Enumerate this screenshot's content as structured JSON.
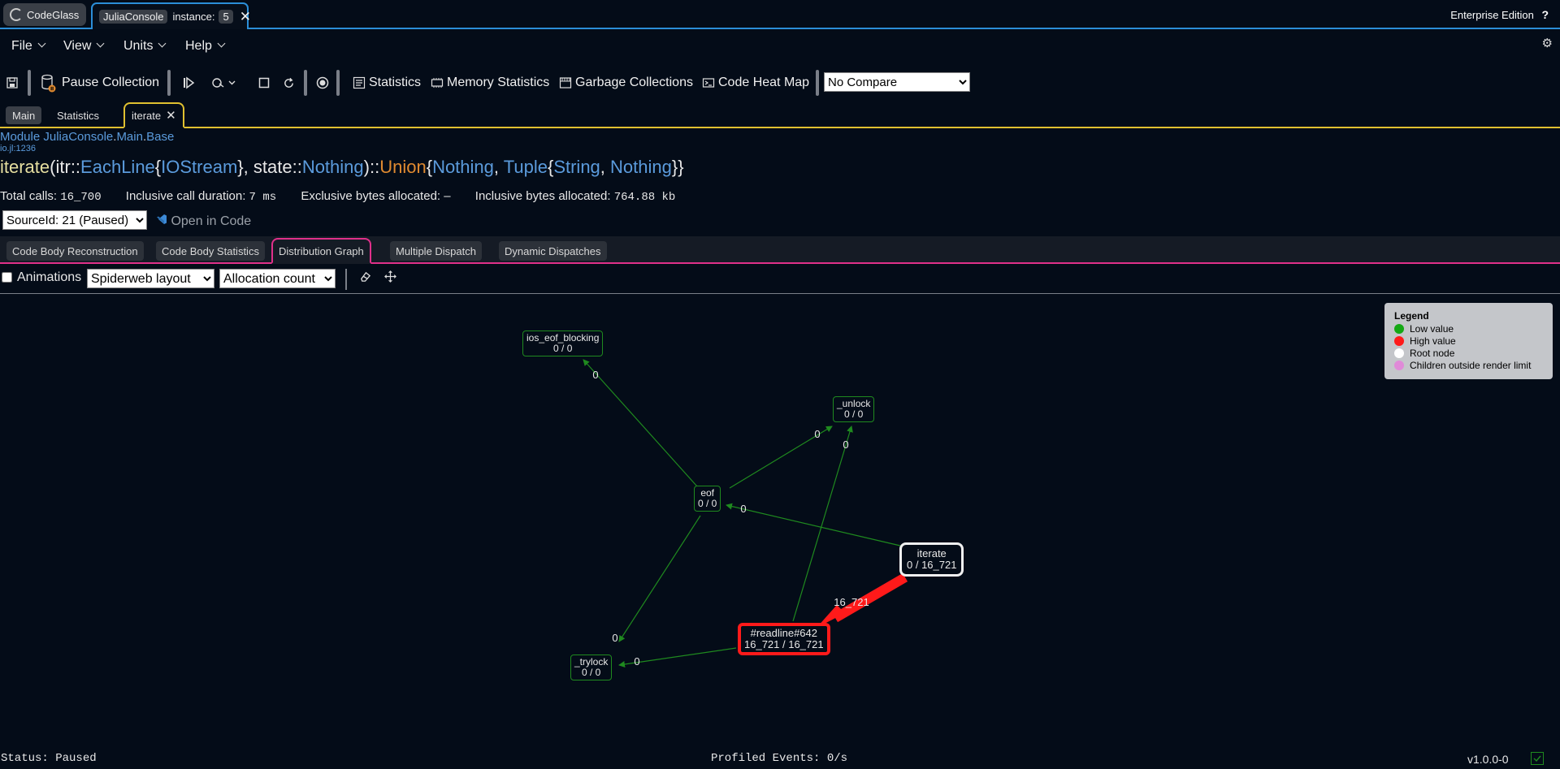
{
  "titlebar": {
    "app_tab": "CodeGlass",
    "instance_tab": {
      "name": "JuliaConsole",
      "label": "instance:",
      "number": "5"
    },
    "edition": "Enterprise Edition",
    "help": "?"
  },
  "menu": {
    "file": "File",
    "view": "View",
    "units": "Units",
    "help": "Help"
  },
  "toolbar": {
    "pause_collection": "Pause Collection",
    "statistics": "Statistics",
    "memory_statistics": "Memory Statistics",
    "garbage_collections": "Garbage Collections",
    "code_heat_map": "Code Heat Map",
    "compare_select": "No Compare"
  },
  "doc_tabs": {
    "main": "Main",
    "statistics": "Statistics",
    "iterate": "iterate"
  },
  "header": {
    "module_prefix": "Module",
    "module_path": [
      "JuliaConsole",
      "Main",
      "Base"
    ],
    "file": "io.jl:1236",
    "signature": {
      "fn": "iterate",
      "arg1": "itr",
      "t1": "EachLine",
      "t1p": "IOStream",
      "arg2": "state",
      "t2": "Nothing",
      "union": "Union",
      "u1": "Nothing",
      "u2": "Tuple",
      "u2a": "String",
      "u2b": "Nothing"
    }
  },
  "stats": {
    "total_calls_label": "Total calls:",
    "total_calls": "16_700",
    "inclusive_duration_label": "Inclusive call duration:",
    "inclusive_duration": "7 ms",
    "exclusive_bytes_label": "Exclusive bytes allocated:",
    "exclusive_bytes": "–",
    "inclusive_bytes_label": "Inclusive bytes allocated:",
    "inclusive_bytes": "764.88 kb"
  },
  "source_select": "SourceId: 21 (Paused)",
  "open_in_code": "Open in Code",
  "sub_tabs": {
    "reconstruction": "Code Body Reconstruction",
    "body_stats": "Code Body Statistics",
    "distribution": "Distribution Graph",
    "multiple_dispatch": "Multiple Dispatch",
    "dynamic_dispatches": "Dynamic Dispatches"
  },
  "graph_options": {
    "animations": "Animations",
    "layout": "Spiderweb layout",
    "metric": "Allocation count"
  },
  "graph": {
    "nodes": {
      "ios_eof_blocking": {
        "name": "ios_eof_blocking",
        "value": "0 / 0"
      },
      "unlock": {
        "name": "_unlock",
        "value": "0 / 0"
      },
      "eof": {
        "name": "eof",
        "value": "0 / 0"
      },
      "iterate": {
        "name": "iterate",
        "value": "0 / 16_721"
      },
      "readline": {
        "name": "#readline#642",
        "value": "16_721 / 16_721"
      },
      "trylock": {
        "name": "_trylock",
        "value": "0 / 0"
      }
    },
    "edges": {
      "eof_ios": "0",
      "eof_unlock": "0",
      "readline_unlock": "0",
      "iterate_eof": "0",
      "iterate_readline": "16_721",
      "eof_trylock": "0",
      "readline_trylock": "0"
    }
  },
  "legend": {
    "title": "Legend",
    "items": [
      {
        "label": "Low value",
        "color": "#14a814"
      },
      {
        "label": "High value",
        "color": "#ff1a1a"
      },
      {
        "label": "Root node",
        "color": "#ffffff"
      },
      {
        "label": "Children outside render limit",
        "color": "#e08ad8"
      }
    ]
  },
  "status": {
    "status": "Status: Paused",
    "events": "Profiled Events: 0/s",
    "version": "v1.0.0-0"
  },
  "colors": {
    "accent_blue": "#2b8ed8",
    "tab_yellow": "#e0c030",
    "tab_pink": "#e0308a",
    "edge_green": "#1f8a1f",
    "hot_red": "#ff1a1a"
  }
}
